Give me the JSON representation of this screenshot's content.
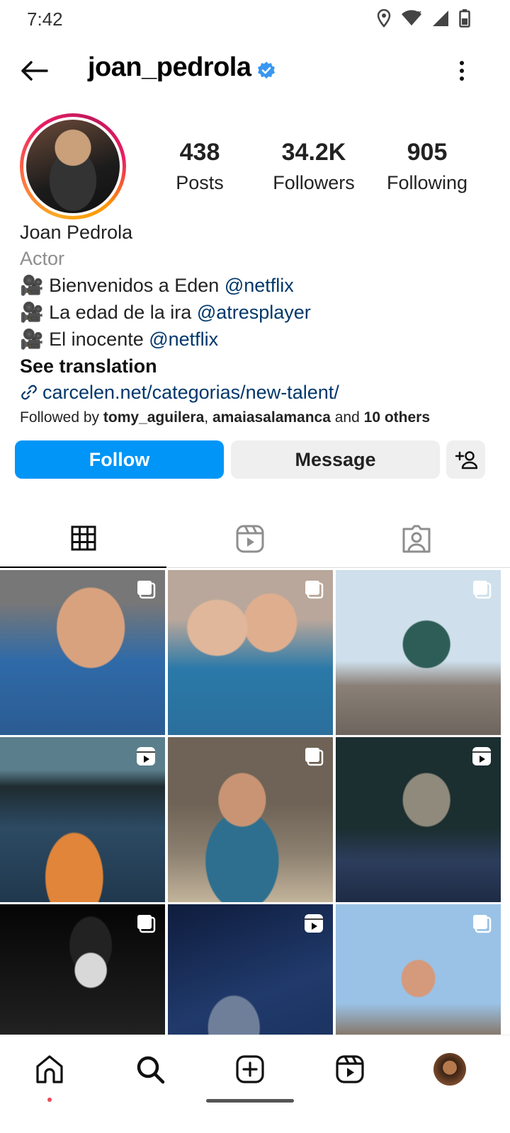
{
  "status_bar": {
    "time": "7:42",
    "icons": [
      "location-icon",
      "wifi-icon",
      "signal-icon",
      "battery-icon"
    ]
  },
  "header": {
    "username": "joan_pedrola",
    "verified": true,
    "icons": [
      "back-arrow-icon",
      "verified-badge-icon",
      "more-vertical-icon"
    ]
  },
  "profile": {
    "stats": [
      {
        "value": "438",
        "label": "Posts"
      },
      {
        "value": "34.2K",
        "label": "Followers"
      },
      {
        "value": "905",
        "label": "Following"
      }
    ]
  },
  "bio": {
    "name": "Joan Pedrola",
    "category": "Actor",
    "lines": [
      {
        "emoji": "🎥",
        "text": "Bienvenidos a Eden ",
        "mention": "@netflix"
      },
      {
        "emoji": "🎥",
        "text": "La edad de la ira ",
        "mention": "@atresplayer"
      },
      {
        "emoji": "🎥",
        "text": "El inocente ",
        "mention": "@netflix"
      }
    ],
    "see_translation": "See translation",
    "link": "carcelen.net/categorias/new-talent/",
    "followed_by": {
      "prefix": "Followed by ",
      "user1": "tomy_aguilera",
      "sep": ", ",
      "user2": "amaiasalamanca",
      "and": " and ",
      "others": "10 others"
    }
  },
  "actions": {
    "follow": "Follow",
    "message": "Message",
    "suggest_icon": "add-person-icon"
  },
  "tabs": [
    {
      "icon": "grid-icon",
      "active": true
    },
    {
      "icon": "reels-icon",
      "active": false
    },
    {
      "icon": "tagged-icon",
      "active": false
    }
  ],
  "grid": {
    "posts": [
      {
        "type": "carousel"
      },
      {
        "type": "carousel"
      },
      {
        "type": "carousel"
      },
      {
        "type": "reel"
      },
      {
        "type": "carousel"
      },
      {
        "type": "reel"
      },
      {
        "type": "carousel"
      },
      {
        "type": "reel"
      },
      {
        "type": "carousel"
      }
    ]
  },
  "bottom_nav": {
    "items": [
      "home-icon",
      "search-icon",
      "create-icon",
      "reels-icon",
      "profile-avatar"
    ],
    "accent_colors": {
      "primary": "#0095f6",
      "notification_dot": "#ed4956"
    }
  }
}
